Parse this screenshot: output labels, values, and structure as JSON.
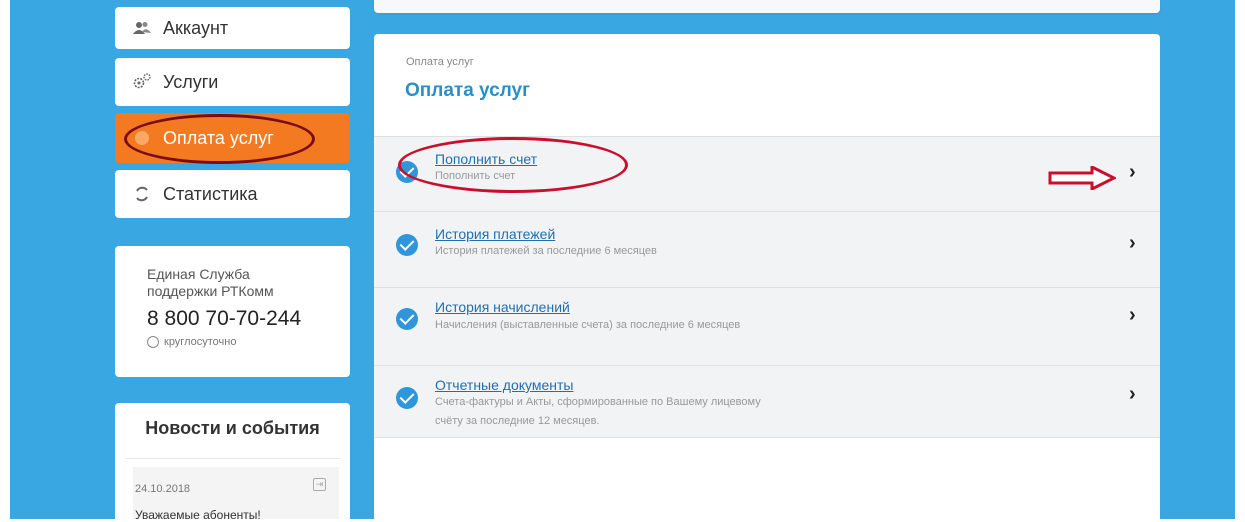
{
  "sidebar": {
    "items": [
      {
        "label": "Аккаунт",
        "icon": "users-icon"
      },
      {
        "label": "Услуги",
        "icon": "gears-icon"
      },
      {
        "label": "Оплата услуг",
        "icon": "payment-icon"
      },
      {
        "label": "Статистика",
        "icon": "refresh-icon"
      }
    ],
    "support": {
      "line1": "Единая Служба",
      "line2": "поддержки РТКомм",
      "phone": "8 800 70-70-244",
      "hours": "круглосуточно"
    },
    "news": {
      "title": "Новости и события",
      "date": "24.10.2018",
      "text": "Уважаемые абоненты!"
    }
  },
  "main": {
    "breadcrumb": "Оплата услуг",
    "title": "Оплата услуг",
    "rows": [
      {
        "title": "Пополнить счет",
        "subtitle": "Пополнить счет"
      },
      {
        "title": "История платежей",
        "subtitle": "История платежей за последние 6 месяцев"
      },
      {
        "title": "История начислений",
        "subtitle": "Начисления (выставленные счета) за последние 6 месяцев"
      },
      {
        "title": "Отчетные документы",
        "subtitle": "Счета-фактуры и Акты, сформированные по Вашему лицевому счёту за последние 12 месяцев."
      }
    ]
  },
  "colors": {
    "background": "#39a8e2",
    "active_item": "#f47a22",
    "title_blue": "#2b8fc7",
    "annotation_red": "#c8102e"
  }
}
